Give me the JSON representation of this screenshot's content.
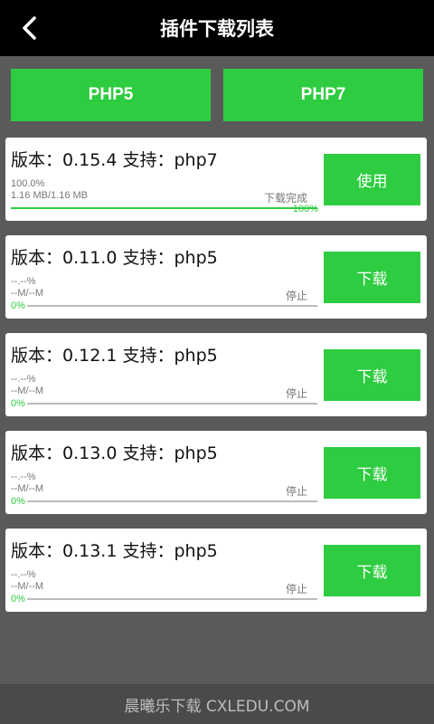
{
  "header": {
    "title": "插件下载列表",
    "back_icon": "chevron-left-icon"
  },
  "tabs": [
    {
      "label": "PHP5"
    },
    {
      "label": "PHP7"
    }
  ],
  "colors": {
    "accent": "#2ecc40",
    "header_bg": "#000000",
    "page_bg": "#5a5a5a"
  },
  "plugins": [
    {
      "title": "版本：0.15.4 支持：php7",
      "percent": "100.0%",
      "size": "1.16 MB/1.16 MB",
      "status": "下载完成",
      "progress": 100,
      "progress_label": "100%",
      "action": "使用"
    },
    {
      "title": "版本：0.11.0 支持：php5",
      "percent": "--.--%",
      "size": "--M/--M",
      "status": "停止",
      "progress": 0,
      "progress_label": "0%",
      "action": "下载"
    },
    {
      "title": "版本：0.12.1 支持：php5",
      "percent": "--.--%",
      "size": "--M/--M",
      "status": "停止",
      "progress": 0,
      "progress_label": "0%",
      "action": "下载"
    },
    {
      "title": "版本：0.13.0 支持：php5",
      "percent": "--.--%",
      "size": "--M/--M",
      "status": "停止",
      "progress": 0,
      "progress_label": "0%",
      "action": "下载"
    },
    {
      "title": "版本：0.13.1 支持：php5",
      "percent": "--.--%",
      "size": "--M/--M",
      "status": "停止",
      "progress": 0,
      "progress_label": "0%",
      "action": "下载"
    }
  ],
  "watermark": "晨曦乐下载 CXLEDU.COM"
}
